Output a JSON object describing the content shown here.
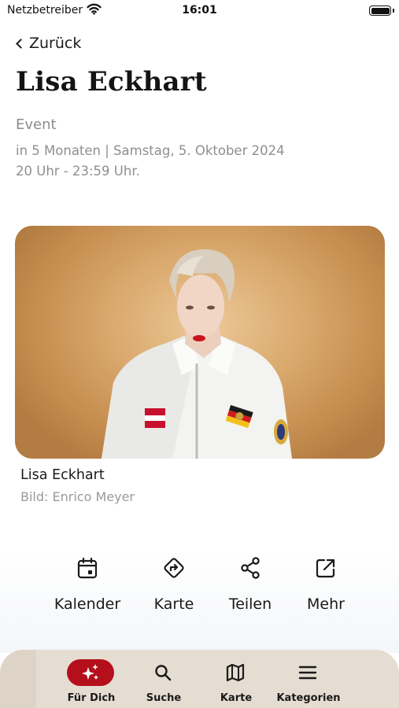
{
  "status_bar": {
    "carrier": "Netzbetreiber",
    "time": "16:01"
  },
  "nav": {
    "back_label": "Zurück"
  },
  "event": {
    "title": "Lisa Eckhart",
    "category": "Event",
    "date_text": "in 5 Monaten | Samstag, 5. Oktober 2024",
    "time_text": "20 Uhr - 23:59 Uhr."
  },
  "image": {
    "caption": "Lisa Eckhart",
    "credit": "Bild: Enrico Meyer"
  },
  "actions": [
    {
      "label": "Kalender",
      "icon": "calendar-icon"
    },
    {
      "label": "Karte",
      "icon": "directions-icon"
    },
    {
      "label": "Teilen",
      "icon": "share-icon"
    },
    {
      "label": "Mehr",
      "icon": "external-link-icon"
    }
  ],
  "tabs": [
    {
      "label": "Für Dich",
      "icon": "sparkles-icon",
      "active": true
    },
    {
      "label": "Suche",
      "icon": "search-icon",
      "active": false
    },
    {
      "label": "Karte",
      "icon": "map-icon",
      "active": false
    },
    {
      "label": "Kategorien",
      "icon": "menu-icon",
      "active": false
    }
  ],
  "colors": {
    "accent": "#b40f1b",
    "tabbar": "#e6ddd2",
    "muted_text": "#8f8f8f"
  }
}
